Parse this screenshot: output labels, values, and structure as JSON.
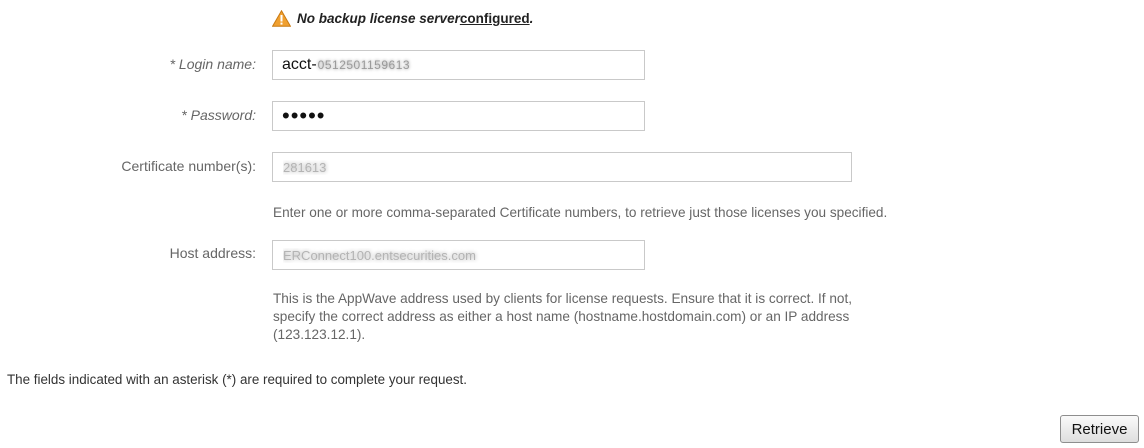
{
  "warning": {
    "text": "No backup license server ",
    "link": "configured",
    "suffix": ".",
    "icon": "warning-icon"
  },
  "login": {
    "label": "* Login name:",
    "value_prefix": "acct-",
    "value_obscured": "0512501159613"
  },
  "password": {
    "label": "* Password:",
    "value": "•••••"
  },
  "certificates": {
    "label": "Certificate number(s):",
    "value": "281613",
    "help": "Enter one or more comma-separated Certificate numbers, to retrieve just those licenses you specified."
  },
  "host": {
    "label": "Host address:",
    "value": "ERConnect100.entsecurities.com",
    "help_lines": [
      "This is the AppWave address used by clients for license requests. Ensure that it is correct. If not,",
      "specify the correct address as either a host name (hostname.hostdomain.com) or an IP address",
      "(123.123.12.1)."
    ]
  },
  "footer_note": "The fields indicated with an asterisk (*) are required to complete your request.",
  "actions": {
    "retrieve_label": "Retrieve"
  },
  "colors": {
    "warning_icon": "#f0a030",
    "label_text": "#666666",
    "field_border": "#c9c9c9"
  }
}
